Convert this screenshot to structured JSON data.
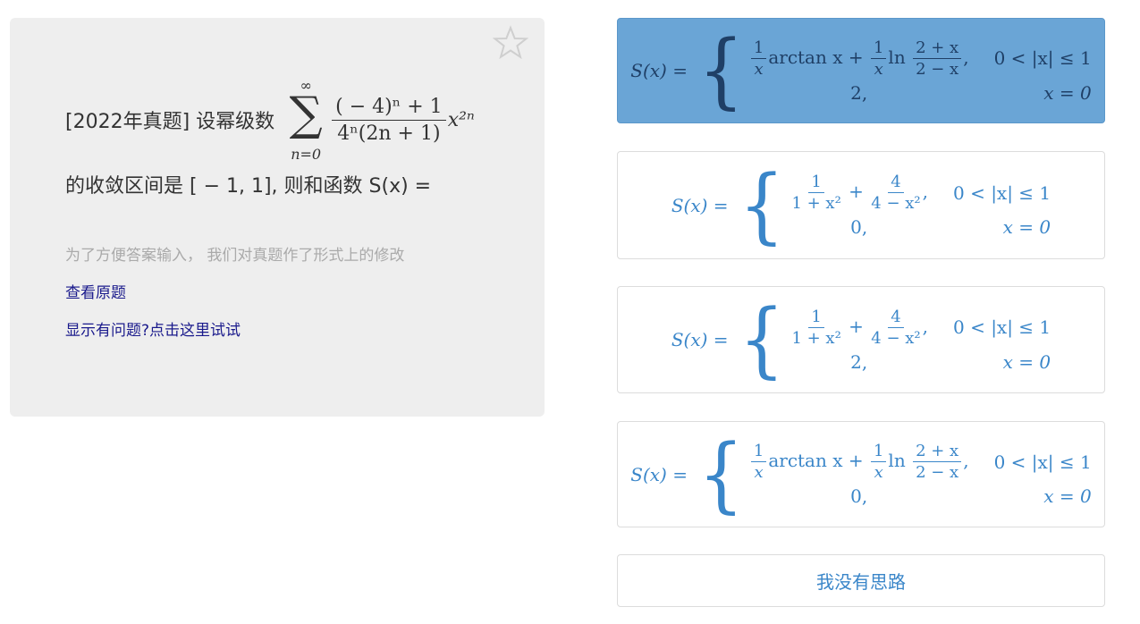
{
  "question": {
    "tag": "[2022年真题] 设幂级数",
    "sum_top": "∞",
    "sum_sym": "∑",
    "sum_bot": "n=0",
    "frac_num": "( − 4)ⁿ + 1",
    "frac_den": "4ⁿ(2n + 1)",
    "power": "x²ⁿ",
    "line2": "的收敛区间是 [ − 1, 1], 则和函数 S(x) ="
  },
  "note": "为了方便答案输入， 我们对真题作了形式上的修改",
  "links": {
    "view_original": "查看原题",
    "display_issue": "显示有问题?点击这里试试"
  },
  "options": [
    {
      "lhs": "S(x) =",
      "row1": {
        "f1n": "1",
        "f1d": "x",
        "mid1": "arctan x +",
        "f2n": "1",
        "f2d": "x",
        "mid2": "ln",
        "f3n": "2 + x",
        "f3d": "2 − x",
        "tail": ",",
        "cond": "0 < |x| ≤ 1"
      },
      "row2": {
        "expr": "2,",
        "cond": "x = 0"
      }
    },
    {
      "lhs": "S(x) =",
      "row1": {
        "f1n": "1",
        "f1d": "1 + x²",
        "mid1": "+",
        "f2n": "4",
        "f2d": "4 − x²",
        "tail": ",",
        "cond": "0 < |x| ≤ 1"
      },
      "row2": {
        "expr": "0,",
        "cond": "x = 0"
      }
    },
    {
      "lhs": "S(x) =",
      "row1": {
        "f1n": "1",
        "f1d": "1 + x²",
        "mid1": "+",
        "f2n": "4",
        "f2d": "4 − x²",
        "tail": ",",
        "cond": "0 < |x| ≤ 1"
      },
      "row2": {
        "expr": "2,",
        "cond": "x = 0"
      }
    },
    {
      "lhs": "S(x) =",
      "row1": {
        "f1n": "1",
        "f1d": "x",
        "mid1": "arctan x +",
        "f2n": "1",
        "f2d": "x",
        "mid2": "ln",
        "f3n": "2 + x",
        "f3d": "2 − x",
        "tail": ",",
        "cond": "0 < |x| ≤ 1"
      },
      "row2": {
        "expr": "0,",
        "cond": "x = 0"
      }
    }
  ],
  "no_idea": "我没有思路",
  "colors": {
    "selected_bg": "#6aa5d6",
    "option_text": "#3a86c9",
    "link": "#1a1a8c",
    "panel_bg": "#eeeeee"
  },
  "icons": {
    "favorite": "star-outline-icon"
  }
}
